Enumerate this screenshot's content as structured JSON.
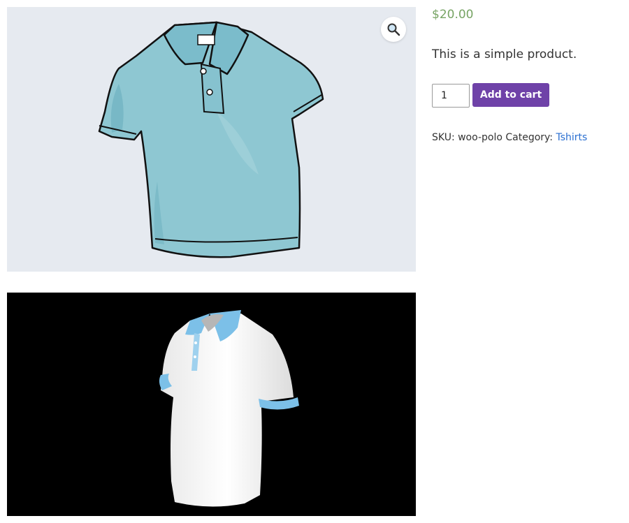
{
  "gallery": {
    "images": [
      {
        "icon": "polo-shirt-sketch-image",
        "background": "#e6eaf0"
      },
      {
        "icon": "white-polo-shirt-render-image",
        "background": "#000000"
      }
    ],
    "zoom_icon": "magnifier-icon"
  },
  "product": {
    "price": "$20.00",
    "short_description": "This is a simple product.",
    "quantity": "1",
    "add_to_cart_label": "Add to cart",
    "sku_label": "SKU:",
    "sku": "woo-polo",
    "category_label": "Category:",
    "category": "Tshirts"
  },
  "colors": {
    "price": "#77a464",
    "button": "#6f42a8",
    "link": "#2a6fd1"
  }
}
